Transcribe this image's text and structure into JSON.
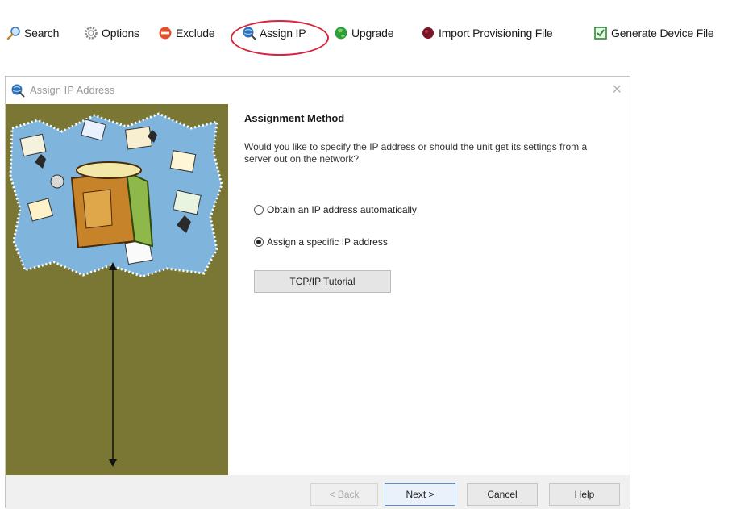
{
  "toolbar": {
    "items": [
      {
        "label": "Search",
        "icon": "magnifier-icon"
      },
      {
        "label": "Options",
        "icon": "gear-icon"
      },
      {
        "label": "Exclude",
        "icon": "exclude-icon"
      },
      {
        "label": "Assign IP",
        "icon": "globe-wand-icon"
      },
      {
        "label": "Upgrade",
        "icon": "green-globe-icon"
      },
      {
        "label": "Import Provisioning File",
        "icon": "dark-red-ball-icon"
      },
      {
        "label": "Generate Device File",
        "icon": "green-file-icon"
      }
    ],
    "highlighted": "Assign IP",
    "highlight_color": "#d8253c"
  },
  "dialog": {
    "title": "Assign IP Address",
    "close_symbol": "×",
    "heading": "Assignment Method",
    "question": "Would you like to specify the IP address or should the unit get its settings from a server out on the network?",
    "options": [
      {
        "label": "Obtain an IP address automatically",
        "selected": false
      },
      {
        "label": "Assign a specific IP address",
        "selected": true
      }
    ],
    "tutorial_button": "TCP/IP Tutorial",
    "buttons": {
      "back": "< Back",
      "next": "Next >",
      "cancel": "Cancel",
      "help": "Help"
    },
    "side_panel_color": "#7a7735"
  }
}
